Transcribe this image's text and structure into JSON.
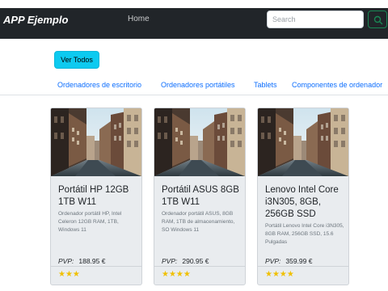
{
  "navbar": {
    "brand": "APP Ejemplo",
    "home_link": "Home",
    "search_placeholder": "Search"
  },
  "toolbar": {
    "ver_todos_label": "Ver Todos"
  },
  "categories": [
    "Ordenadores de escritorio",
    "Ordenadores portátiles",
    "Tablets",
    "Componentes de ordenador"
  ],
  "products": [
    {
      "title": "Portátil HP 12GB 1TB W11",
      "description": "Ordenador portátil HP, Intel Celeron 12GB RAM, 1TB, Windows 11",
      "price_label": "PVP:",
      "price": "188.95 €",
      "rating": 3,
      "stars": "★★★"
    },
    {
      "title": "Portátil ASUS 8GB 1TB W11",
      "description": "Ordenador portátil ASUS, 8GB RAM, 1TB de almacenamiento, SO Windows 11",
      "price_label": "PVP:",
      "price": "290.95 €",
      "rating": 4,
      "stars": "★★★★"
    },
    {
      "title": "Lenovo Intel Core i3N305, 8GB, 256GB SSD",
      "description": "Portátil Lenovo Intel Core i3N305, 8GB RAM, 256GB SSD, 15.6 Pulgadas",
      "price_label": "PVP:",
      "price": "359.99 €",
      "rating": 4,
      "stars": "★★★★"
    }
  ],
  "colors": {
    "navbar_bg": "#212529",
    "accent_button": "#0dcaf0",
    "link": "#0d6efd",
    "star": "#f0c000",
    "search_button_border": "#198754"
  }
}
